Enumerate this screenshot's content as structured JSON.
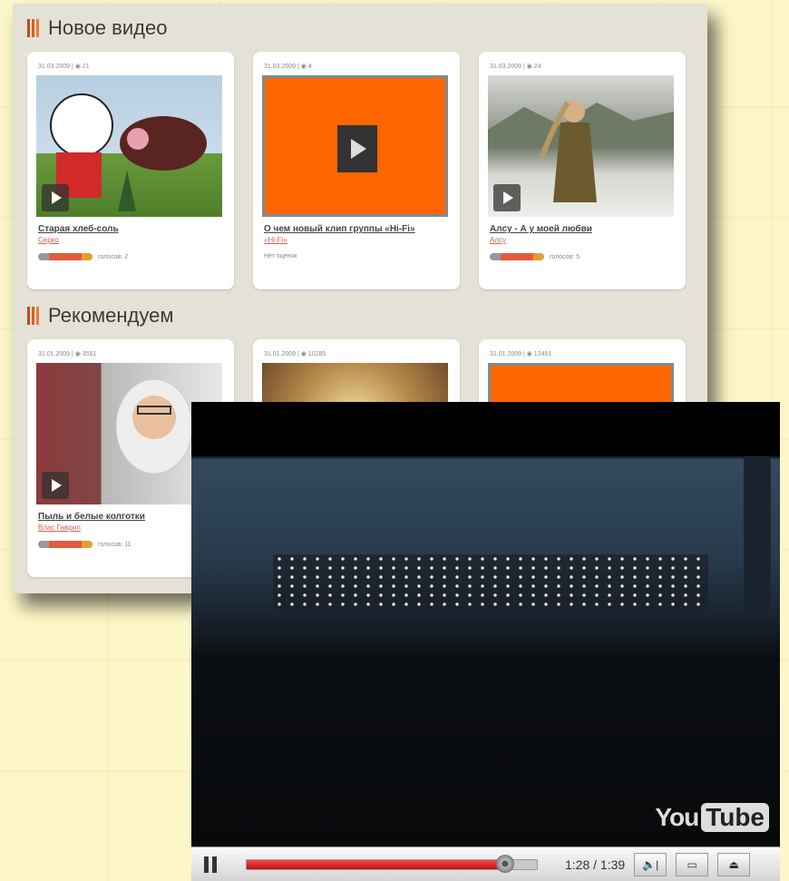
{
  "site": {
    "section_new": "Новое видео",
    "section_recommended": "Рекомендуем",
    "new_videos": [
      {
        "meta": "31.03.2009 | ◉ 21",
        "title": "Старая хлеб-соль",
        "author": "Серко",
        "rating_text": "голосов: 2"
      },
      {
        "meta": "31.03.2009 | ◉ 4",
        "title": "О чем новый клип группы «Hi-Fi»",
        "author": "«Hi-Fi»",
        "rating_text": "Нет оценок"
      },
      {
        "meta": "31.03.2009 | ◉ 24",
        "title": "Алсу - А у моей любви",
        "author": "Алсу",
        "rating_text": "голосов: 5"
      }
    ],
    "recommended": [
      {
        "meta": "31.01.2009 | ◉ 3551",
        "title": "Пыль и белые колготки",
        "author": "Влас Гаврил",
        "rating_text": "голосов: 11"
      },
      {
        "meta": "31.01.2009 | ◉ 10285"
      },
      {
        "meta": "31.01.2009 | ◉ 12451"
      }
    ]
  },
  "player": {
    "logo_you": "You",
    "logo_tube": "Tube",
    "time": "1:28 / 1:39",
    "progress": 0.89
  }
}
